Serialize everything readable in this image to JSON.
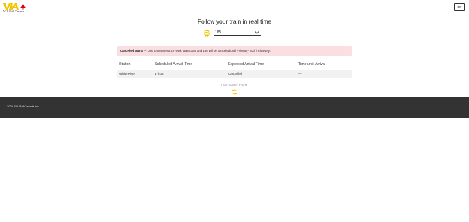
{
  "header": {
    "logo_text": "VIA Rail Canada",
    "lang_button": "FR"
  },
  "main": {
    "title": "Follow your train in real time",
    "train_select": {
      "value": "185",
      "icon": "train-icon"
    },
    "alert": {
      "title": "Cancelled trains",
      "message": " — Due to maintenance work, trains 185 and 186 will be canceled until February 20th inclusively."
    },
    "table": {
      "headers": [
        "Station",
        "Scheduled Arrival Time",
        "Expected Arrival Time",
        "Time until Arrival"
      ],
      "rows": [
        [
          "White River",
          "17h05",
          "Cancelled",
          "—"
        ]
      ]
    },
    "last_update": "Last update: 22m11",
    "refresh_icon": "refresh-icon"
  },
  "footer": {
    "copyright": "2025 VIA Rail Canada Inc."
  },
  "colors": {
    "brand_yellow": "#f5c400",
    "brand_red": "#d6001c",
    "alert_bg": "#f9dfe2",
    "row_bg": "#f2f2f2",
    "footer_bg": "#333333"
  }
}
